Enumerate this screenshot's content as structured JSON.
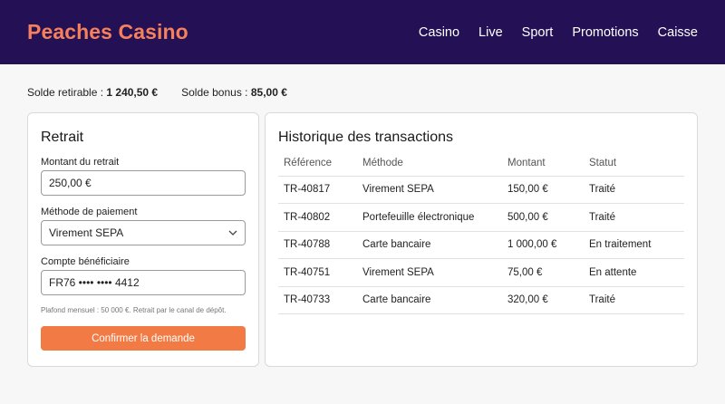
{
  "header": {
    "brand": "Peaches Casino",
    "nav": [
      "Casino",
      "Live",
      "Sport",
      "Promotions",
      "Caisse"
    ]
  },
  "balances": {
    "withdrawable_label": "Solde retirable :",
    "withdrawable_value": "1 240,50 €",
    "bonus_label": "Solde bonus :",
    "bonus_value": "85,00 €"
  },
  "withdraw": {
    "title": "Retrait",
    "amount_label": "Montant du retrait",
    "amount_value": "250,00 €",
    "method_label": "Méthode de paiement",
    "method_value": "Virement SEPA",
    "account_label": "Compte bénéficiaire",
    "account_value": "FR76 •••• •••• 4412",
    "hint": "Plafond mensuel : 50 000 €. Retrait par le canal de dépôt.",
    "submit_label": "Confirmer la demande"
  },
  "history": {
    "title": "Historique des transactions",
    "columns": [
      "Référence",
      "Méthode",
      "Montant",
      "Statut"
    ],
    "rows": [
      [
        "TR-40817",
        "Virement SEPA",
        "150,00 €",
        "Traité"
      ],
      [
        "TR-40802",
        "Portefeuille électronique",
        "500,00 €",
        "Traité"
      ],
      [
        "TR-40788",
        "Carte bancaire",
        "1 000,00 €",
        "En traitement"
      ],
      [
        "TR-40751",
        "Virement SEPA",
        "75,00 €",
        "En attente"
      ],
      [
        "TR-40733",
        "Carte bancaire",
        "320,00 €",
        "Traité"
      ]
    ]
  },
  "colors": {
    "header_bg": "#231055",
    "brand": "#f5805a",
    "accent_button": "#f27b45"
  },
  "icons": {
    "select_chevron": "chevron-down-icon"
  }
}
